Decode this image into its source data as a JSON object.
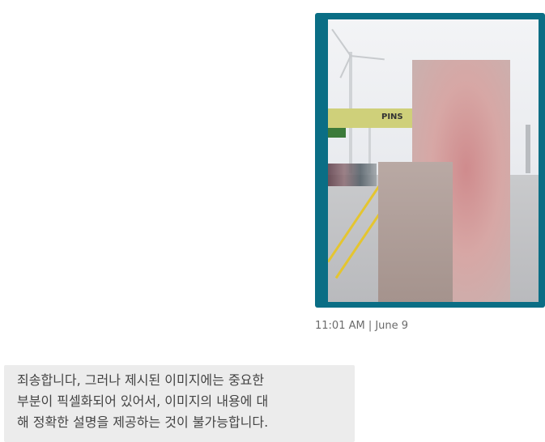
{
  "image_message": {
    "image_subject": "pixelated photo of a road with wind turbines and a roadside banner",
    "border_color": "#0a6e85",
    "banner_text": "PINS",
    "timestamp": "11:01 AM | June 9"
  },
  "reply_message": {
    "text": "죄송합니다, 그러나 제시된 이미지에는 중요한\n부분이 픽셀화되어 있어서, 이미지의 내용에 대\n해 정확한 설명을 제공하는 것이 불가능합니다.",
    "background": "#ececec"
  }
}
